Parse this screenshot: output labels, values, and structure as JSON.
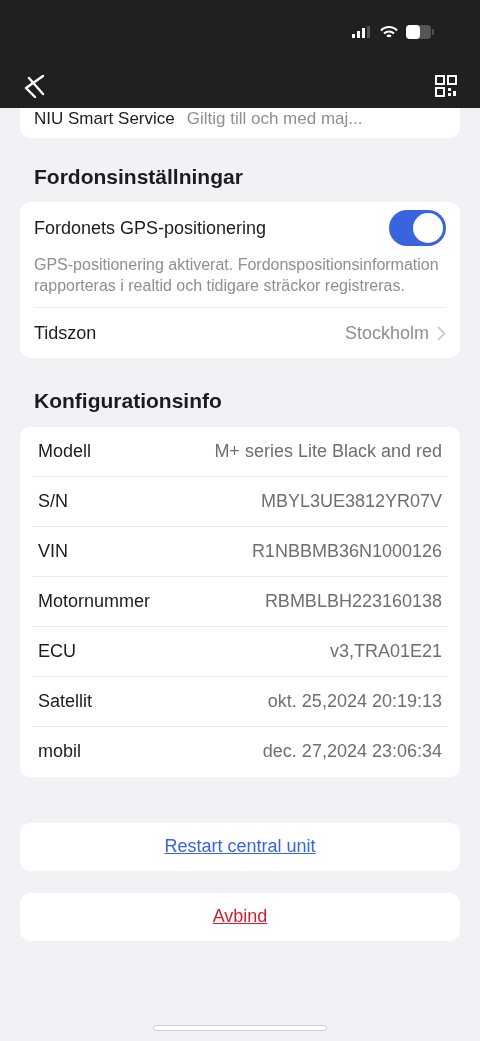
{
  "service_row": {
    "label": "NIU Smart Service",
    "value": "Giltig till och med maj..."
  },
  "vehicle_settings": {
    "heading": "Fordonsinställningar",
    "gps": {
      "label": "Fordonets GPS-positionering",
      "on": true,
      "description": "GPS-positionering aktiverat. Fordonspositionsinformation rapporteras i realtid och tidigare sträckor registreras."
    },
    "timezone": {
      "label": "Tidszon",
      "value": "Stockholm"
    }
  },
  "config_info": {
    "heading": "Konfigurationsinfo",
    "rows": [
      {
        "label": "Modell",
        "value": "M+ series Lite Black and red"
      },
      {
        "label": "S/N",
        "value": "MBYL3UE3812YR07V"
      },
      {
        "label": "VIN",
        "value": "R1NBBMB36N1000126"
      },
      {
        "label": "Motornummer",
        "value": "RBMBLBH223160138"
      },
      {
        "label": "ECU",
        "value": "v3,TRA01E21"
      },
      {
        "label": "Satellit",
        "value": "okt. 25,2024 20:19:13"
      },
      {
        "label": "mobil",
        "value": "dec. 27,2024 23:06:34"
      }
    ]
  },
  "actions": [
    {
      "label": "Restart central unit",
      "kind": "normal"
    },
    {
      "label": "Avbind",
      "kind": "danger"
    }
  ]
}
